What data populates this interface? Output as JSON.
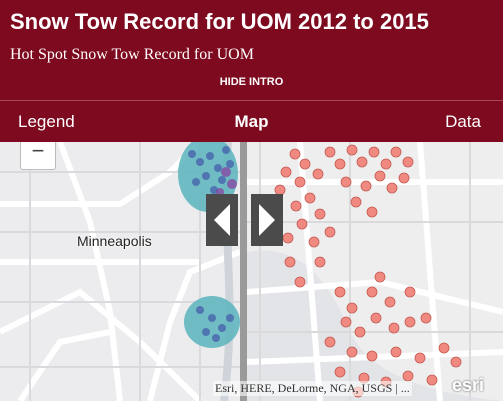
{
  "header": {
    "title": "Snow Tow Record for UOM 2012 to 2015",
    "subtitle": "Hot Spot Snow Tow Record for UOM",
    "hide_intro": "HIDE INTRO"
  },
  "tabs": [
    {
      "label": "Legend"
    },
    {
      "label": "Map",
      "active": true
    },
    {
      "label": "Data"
    }
  ],
  "map": {
    "zoom_out_label": "−",
    "place_label": "Minneapolis",
    "attribution": "Esri, HERE, DeLorme, NGA, USGS | ...",
    "logo": "esri",
    "swipe_left_icon": "triangle-left-icon",
    "swipe_right_icon": "triangle-right-icon"
  },
  "colors": {
    "header_bg": "#7d0a1f",
    "hotspot_point": "#f08a80",
    "cluster_blue": "#4d6fb0",
    "heat_teal": "#5bb4bd"
  }
}
